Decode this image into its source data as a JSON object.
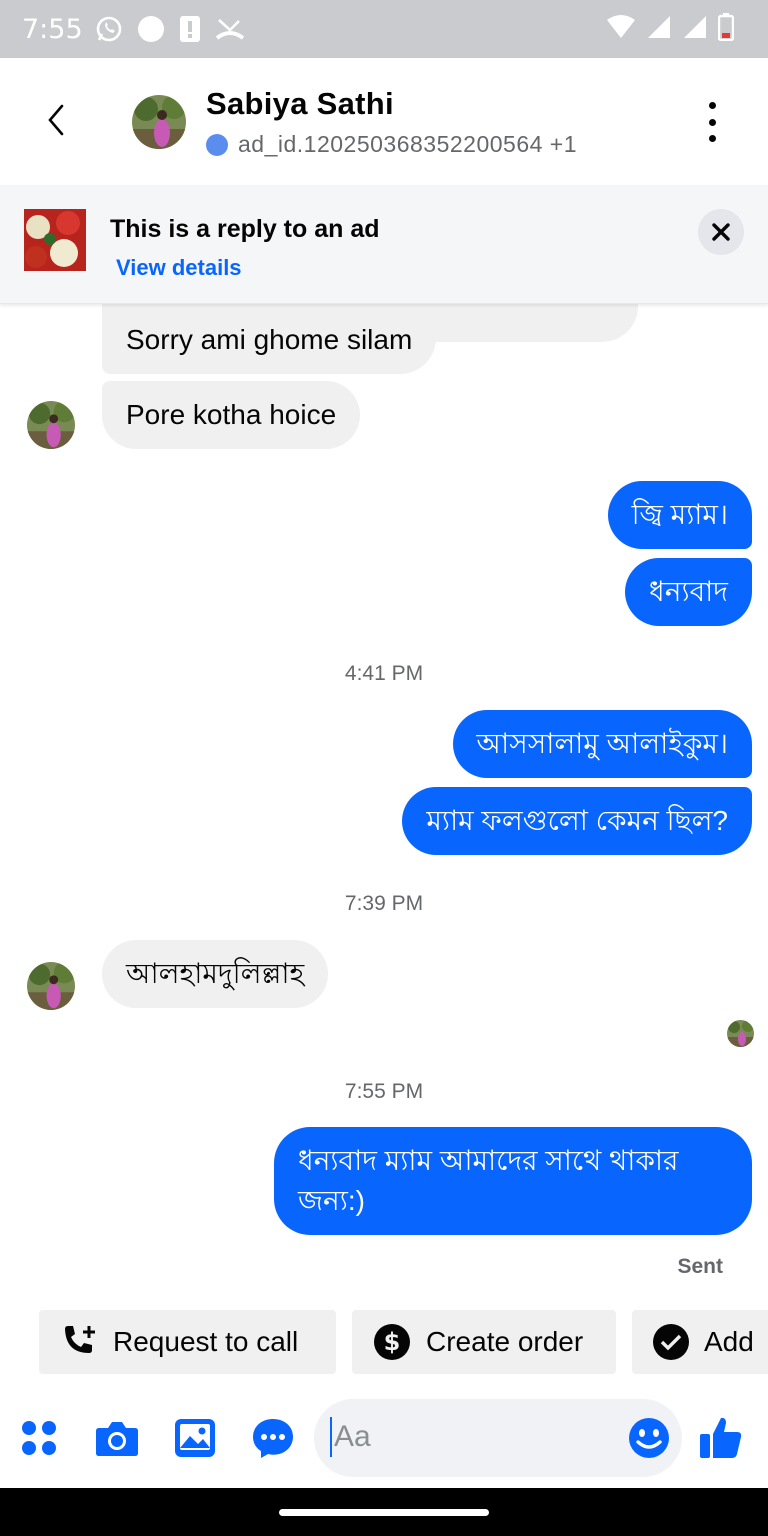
{
  "status_bar": {
    "time": "7:55",
    "left_icons": [
      "whatsapp-icon",
      "circle-icon",
      "alert-icon",
      "missed-call-icon"
    ],
    "right_icons": [
      "wifi-icon",
      "signal-icon",
      "signal-icon",
      "battery-icon"
    ]
  },
  "header": {
    "contact_name": "Sabiya Sathi",
    "subtitle": "ad_id.120250368352200564 +1"
  },
  "ad_banner": {
    "title": "This is a reply to an ad",
    "link": "View details"
  },
  "messages": [
    {
      "from": "them",
      "text": "Sorry ami ghome silam"
    },
    {
      "from": "them",
      "text": "Pore kotha hoice"
    },
    {
      "from": "me",
      "text": "জ্বি ম্যাম।"
    },
    {
      "from": "me",
      "text": "ধন্যবাদ"
    },
    {
      "from": "me",
      "text": "আসসালামু আলাইকুম।"
    },
    {
      "from": "me",
      "text": "ম্যাম ফলগুলো কেমন ছিল?"
    },
    {
      "from": "them",
      "text": "আলহামদুলিল্লাহ"
    },
    {
      "from": "me",
      "text": "ধন্যবাদ ম্যাম আমাদের সাথে থাকার",
      "text_line2": "জন্য:)"
    }
  ],
  "timestamps": [
    "4:41 PM",
    "7:39 PM",
    "7:55 PM"
  ],
  "sent_status": "Sent",
  "quick_actions": [
    {
      "label": "Request to call",
      "icon": "phone-plus-icon"
    },
    {
      "label": "Create order",
      "icon": "dollar-icon"
    },
    {
      "label": "Add",
      "icon": "check-circle-icon"
    }
  ],
  "composer": {
    "placeholder": "Aa",
    "icons": [
      "apps-icon",
      "camera-icon",
      "gallery-icon",
      "chat-bubble-icon",
      "emoji-icon",
      "like-icon"
    ]
  },
  "colors": {
    "accent": "#0866ff",
    "incoming_bubble": "#f0f0f0",
    "status_bar": "#c9cbcf"
  }
}
